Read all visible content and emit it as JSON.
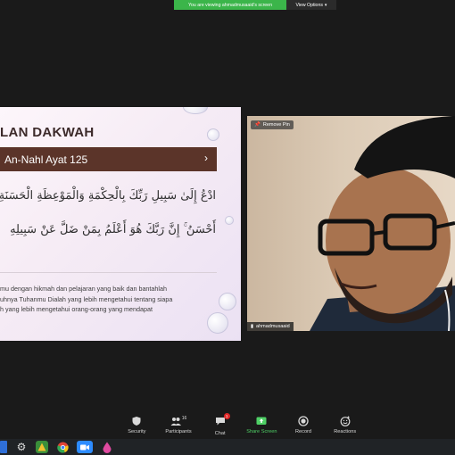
{
  "share_banner": {
    "viewing_text": "You are viewing ahmadmusaaid's screen",
    "view_options_label": "View Options"
  },
  "slide": {
    "title": "LAN DAKWAH",
    "band_title": "An-Nahl Ayat 125",
    "arabic_line_1": "ادْعُ إِلَىٰ سَبِيلِ رَبِّكَ بِالْحِكْمَةِ وَالْمَوْعِظَةِ الْحَسَنَةِ",
    "arabic_line_2": "أَحْسَنُ ۚ إِنَّ رَبَّكَ هُوَ أَعْلَمُ بِمَنْ ضَلَّ عَنْ سَبِيلِهِ",
    "translation_lines": [
      "mu dengan hikmah dan pelajaran yang baik dan bantahlah",
      "uhnya Tuhanmu Dialah yang lebih mengetahui tentang siapa",
      "h yang lebih mengetahui orang-orang yang mendapat"
    ]
  },
  "video": {
    "remove_pin_label": "Remove Pin",
    "participant_name": "ahmadmusaaid"
  },
  "toolbar": {
    "security": "Security",
    "participants": "Participants",
    "participants_count": "16",
    "chat": "Chat",
    "chat_badge": "1",
    "share_screen": "Share Screen",
    "record": "Record",
    "reactions": "Reactions"
  },
  "colors": {
    "banner_green": "#3bb54a",
    "slide_band": "#5b3429",
    "share_green": "#4fd066"
  }
}
